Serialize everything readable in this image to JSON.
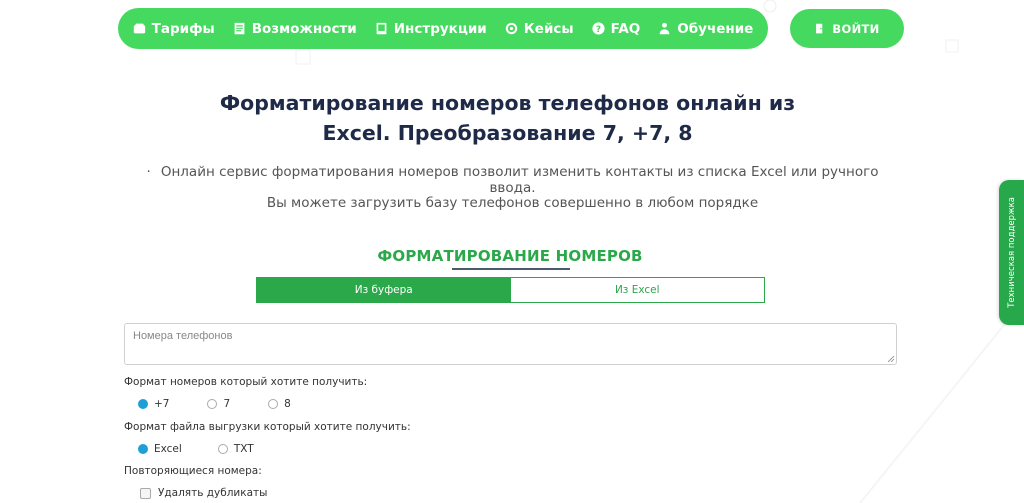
{
  "nav": {
    "items": [
      {
        "label": "Тарифы",
        "icon": "wallet-icon"
      },
      {
        "label": "Возможности",
        "icon": "checklist-icon"
      },
      {
        "label": "Инструкции",
        "icon": "book-icon"
      },
      {
        "label": "Кейсы",
        "icon": "target-icon"
      },
      {
        "label": "FAQ",
        "icon": "question-icon"
      },
      {
        "label": "Обучение",
        "icon": "teacher-icon"
      }
    ],
    "login_label": "ВОЙТИ"
  },
  "hero": {
    "title_line1": "Форматирование номеров телефонов онлайн из",
    "title_line2": "Excel. Преобразование 7, +7, 8",
    "subtitle_dot": "·",
    "subtitle1": "Онлайн сервис форматирования номеров позволит изменить контакты из списка Excel или ручного ввода.",
    "subtitle2": "Вы можете загрузить базу телефонов совершенно в любом порядке"
  },
  "section": {
    "title": "ФОРМАТИРОВАНИЕ НОМЕРОВ"
  },
  "tabs": [
    {
      "label": "Из буфера",
      "active": true
    },
    {
      "label": "Из Excel",
      "active": false
    }
  ],
  "form": {
    "phones_placeholder": "Номера телефонов",
    "format_label": "Формат номеров который хотите получить:",
    "format_options": [
      {
        "label": "+7",
        "checked": true
      },
      {
        "label": "7",
        "checked": false
      },
      {
        "label": "8",
        "checked": false
      }
    ],
    "file_label": "Формат файла выгрузки который хотите получить:",
    "file_options": [
      {
        "label": "Excel",
        "checked": true
      },
      {
        "label": "TXT",
        "checked": false
      }
    ],
    "duplicates_label": "Повторяющиеся номера:",
    "remove_duplicates_label": "Удалять дубликаты"
  },
  "support": {
    "label": "Техническая поддержка"
  },
  "colors": {
    "accent": "#46d95f",
    "accent_dark": "#2aa84a",
    "radio_checked": "#1e9fd6",
    "title": "#1e2a47"
  }
}
